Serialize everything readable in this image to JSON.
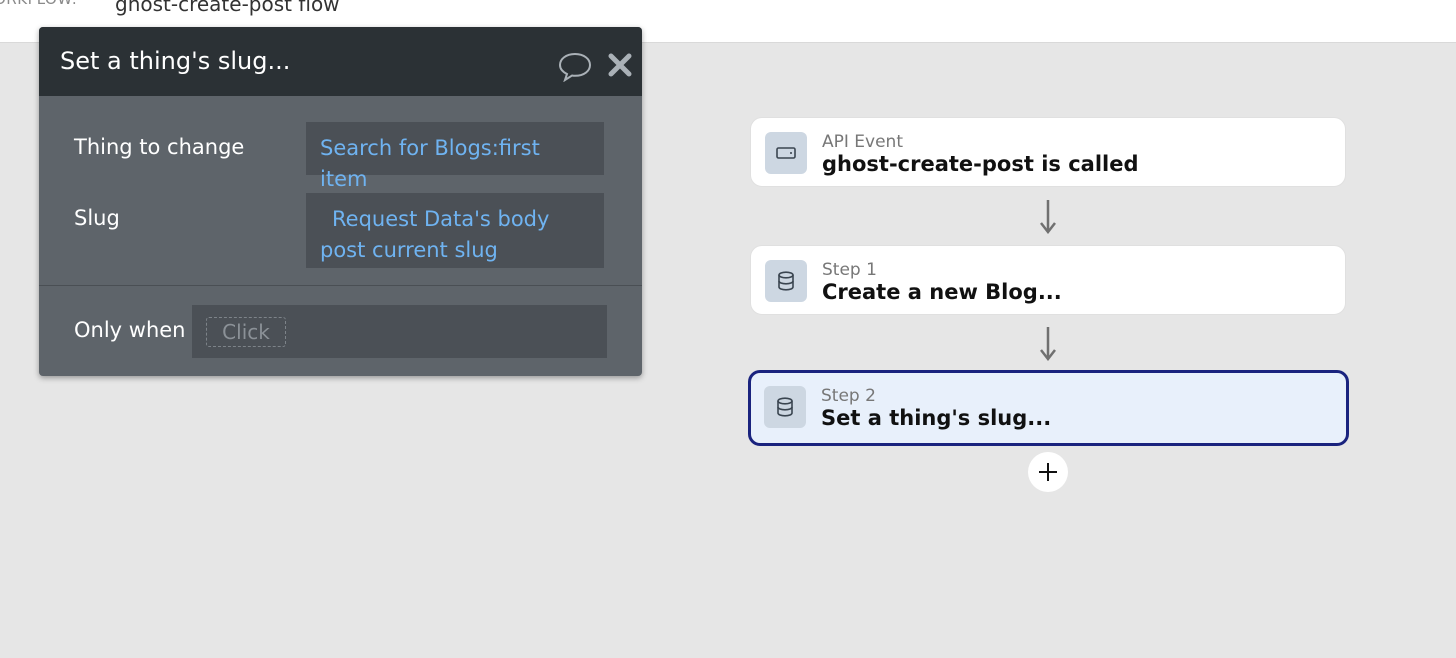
{
  "topbar": {
    "workflow_label": "ORKFLOW:",
    "workflow_name": "ghost-create-post flow"
  },
  "panel": {
    "title": "Set a thing's slug...",
    "fields": [
      {
        "label": "Thing to change",
        "value": "Search for Blogs:first item"
      },
      {
        "label": "Slug",
        "value": "Request Data's body post current slug"
      }
    ],
    "only_when_label": "Only when",
    "only_when_placeholder": "Click",
    "icons": {
      "comment": "comment-icon",
      "close": "close-icon"
    }
  },
  "workflow": {
    "cards": [
      {
        "sub": "API Event",
        "main": "ghost-create-post is called",
        "icon": "api-event-icon",
        "selected": false
      },
      {
        "sub": "Step 1",
        "main": "Create a new Blog...",
        "icon": "database-icon",
        "selected": false
      },
      {
        "sub": "Step 2",
        "main": "Set a thing's slug...",
        "icon": "database-icon",
        "selected": true
      }
    ],
    "add_icon": "plus-icon"
  },
  "colors": {
    "panel_header": "#2b3135",
    "panel_body": "#5e646a",
    "value_text": "#6fb3f1",
    "selected_border": "#1a237e",
    "selected_bg": "#e8f0fb",
    "canvas_bg": "#e6e6e6"
  }
}
